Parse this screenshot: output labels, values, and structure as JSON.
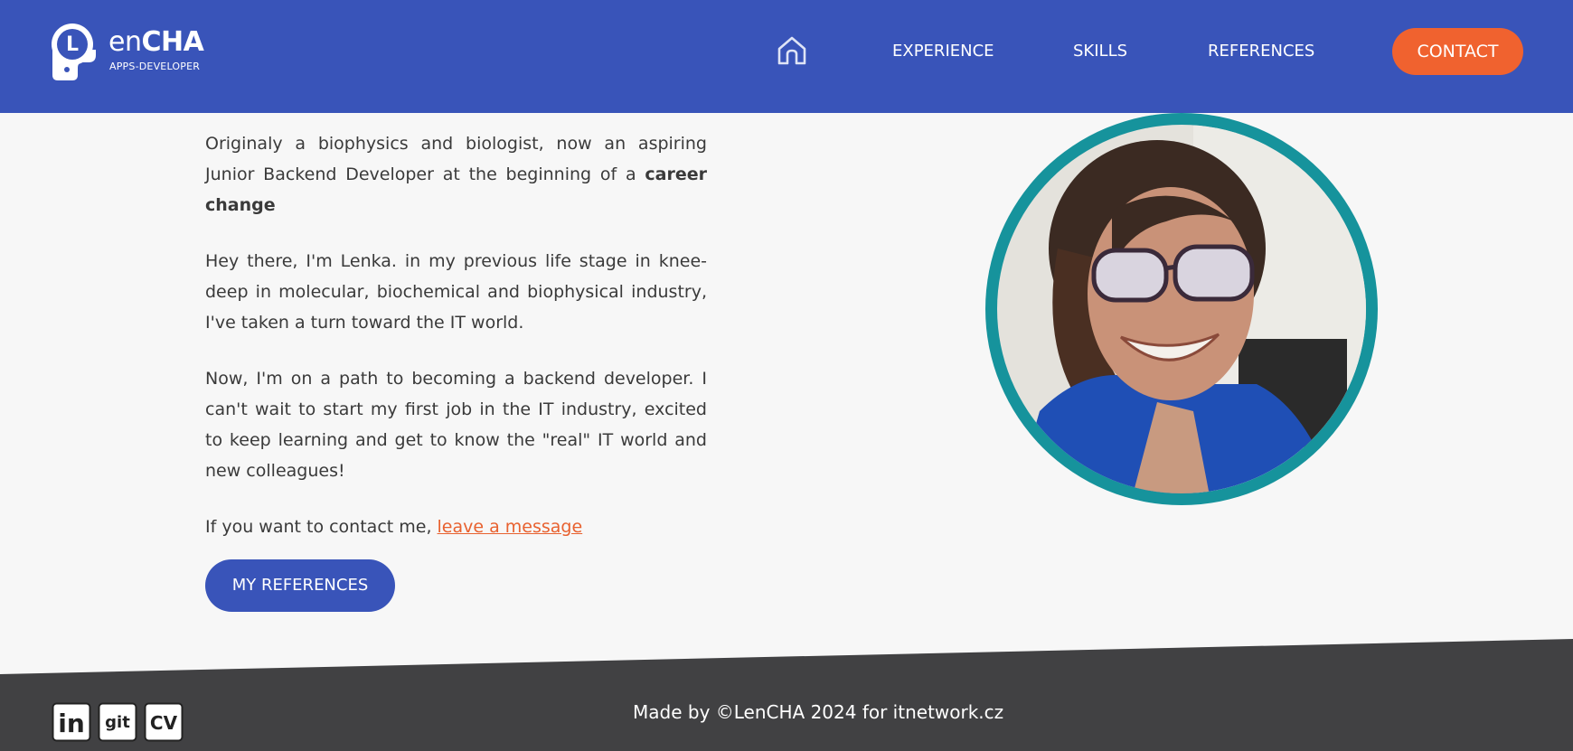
{
  "header": {
    "logo": {
      "name_prefix": "en",
      "name_bold": "CHA",
      "subtitle": "APPS-DEVELOPER",
      "mark_letter": "L"
    },
    "nav": [
      {
        "label": "EXPERIENCE"
      },
      {
        "label": "SKILLS"
      },
      {
        "label": "REFERENCES"
      }
    ],
    "home_icon": "home-icon",
    "contact_label": "CONTACT"
  },
  "about": {
    "intro_text": "Originaly a biophysics and biologist, now an aspiring Junior Backend Developer at the beginning of a ",
    "intro_bold": "career change",
    "paragraph_2": "Hey there, I'm Lenka. in my previous life stage in knee-deep in molecular, biochemical and biophysical industry, I've taken a turn toward the IT world.",
    "paragraph_3": "Now, I'm on a path to becoming a backend developer. I can't wait to start my first job in the IT industry, excited to keep learning and get to know the \"real\" IT world and new colleagues!",
    "contact_prefix": "If you want to contact me, ",
    "contact_link": "leave a message",
    "references_button": "MY REFERENCES"
  },
  "footer": {
    "social": [
      {
        "label": "in",
        "icon": "linkedin-icon"
      },
      {
        "label": "git",
        "icon": "git-icon"
      },
      {
        "label": "cv",
        "icon": "cv-icon"
      }
    ],
    "credits": "Made by ©LenCHA 2024 for itnetwork.cz"
  },
  "colors": {
    "header_bg": "#3954b9",
    "accent_orange": "#f0622f",
    "footer_bg": "#414143",
    "portrait_ring": "#16939c",
    "page_bg": "#f7f7f7"
  }
}
